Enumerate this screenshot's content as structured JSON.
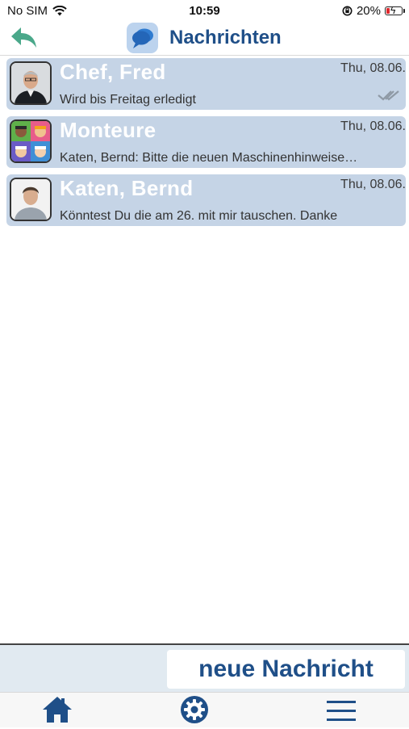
{
  "status_bar": {
    "carrier": "No SIM",
    "time": "10:59",
    "battery": "20%"
  },
  "header": {
    "title": "Nachrichten"
  },
  "conversations": [
    {
      "name": "Chef, Fred",
      "date": "Thu, 08.06.",
      "preview": "Wird bis Freitag erledigt",
      "read_ticks": true
    },
    {
      "name": "Monteure",
      "date": "Thu, 08.06.",
      "preview": "Katen, Bernd: Bitte die neuen Maschinenhinweise…",
      "read_ticks": false
    },
    {
      "name": "Katen, Bernd",
      "date": "Thu, 08.06.",
      "preview": "Könntest Du die am 26. mit mir tauschen. Danke",
      "read_ticks": false
    }
  ],
  "actions": {
    "new_message_label": "neue Nachricht"
  },
  "tabs": [
    {
      "icon": "home-icon"
    },
    {
      "icon": "gear-icon"
    },
    {
      "icon": "menu-icon"
    }
  ],
  "colors": {
    "accent": "#1f4f88",
    "row_background": "#c5d4e6",
    "back_arrow": "#4aa88a",
    "battery_low": "#e0282d"
  }
}
